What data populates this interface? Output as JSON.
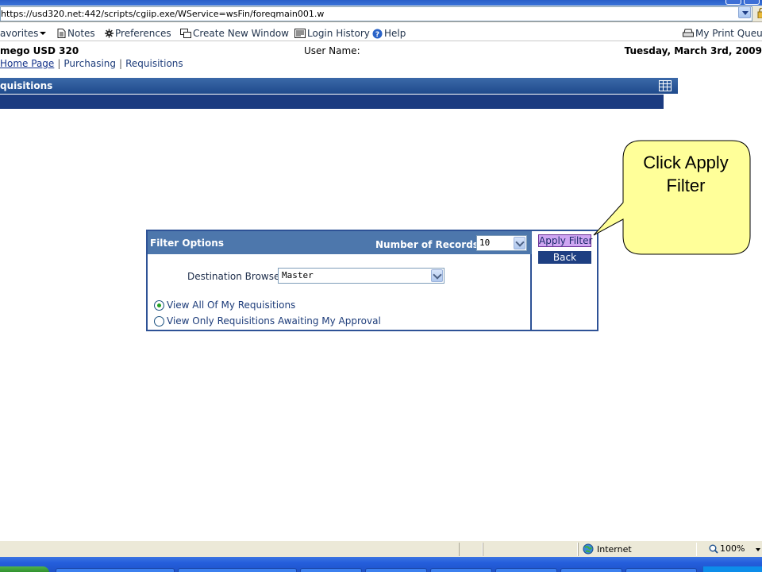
{
  "browser": {
    "address": "https://usd320.net:442/scripts/cgiip.exe/WService=wsFin/foreqmain001.w"
  },
  "toolbar": {
    "favorites": "avorites",
    "notes": "Notes",
    "preferences": "Preferences",
    "new_window": "Create New Window",
    "login_history": "Login History",
    "help": "Help",
    "print_queue": "My Print Queue"
  },
  "info": {
    "org": "mego USD 320",
    "user": "User Name:",
    "date": "Tuesday, March 3rd, 2009"
  },
  "breadcrumb": {
    "home": "Home Page",
    "purchasing": "Purchasing",
    "requisitions": "Requisitions",
    "separator": "|"
  },
  "section": {
    "title": "quisitions"
  },
  "filter": {
    "title": "Filter Options",
    "records_label": "Number of Records:",
    "records_value": "10",
    "destination_label": "Destination Browse:",
    "destination_value": "Master",
    "radio_all": "View All Of My Requisitions",
    "radio_approval": "View Only Requisitions Awaiting My Approval",
    "selected": "all",
    "apply_label": "Apply Filter",
    "back_label": "Back"
  },
  "callout": {
    "line1": "Click Apply",
    "line2": "Filter",
    "fill": "#ffff99"
  },
  "status": {
    "zone": "Internet",
    "zoom": "100%"
  },
  "colors": {
    "header": "#2a5596",
    "apply_bg": "#cfa6f2",
    "back_bg": "#1e3f82"
  }
}
